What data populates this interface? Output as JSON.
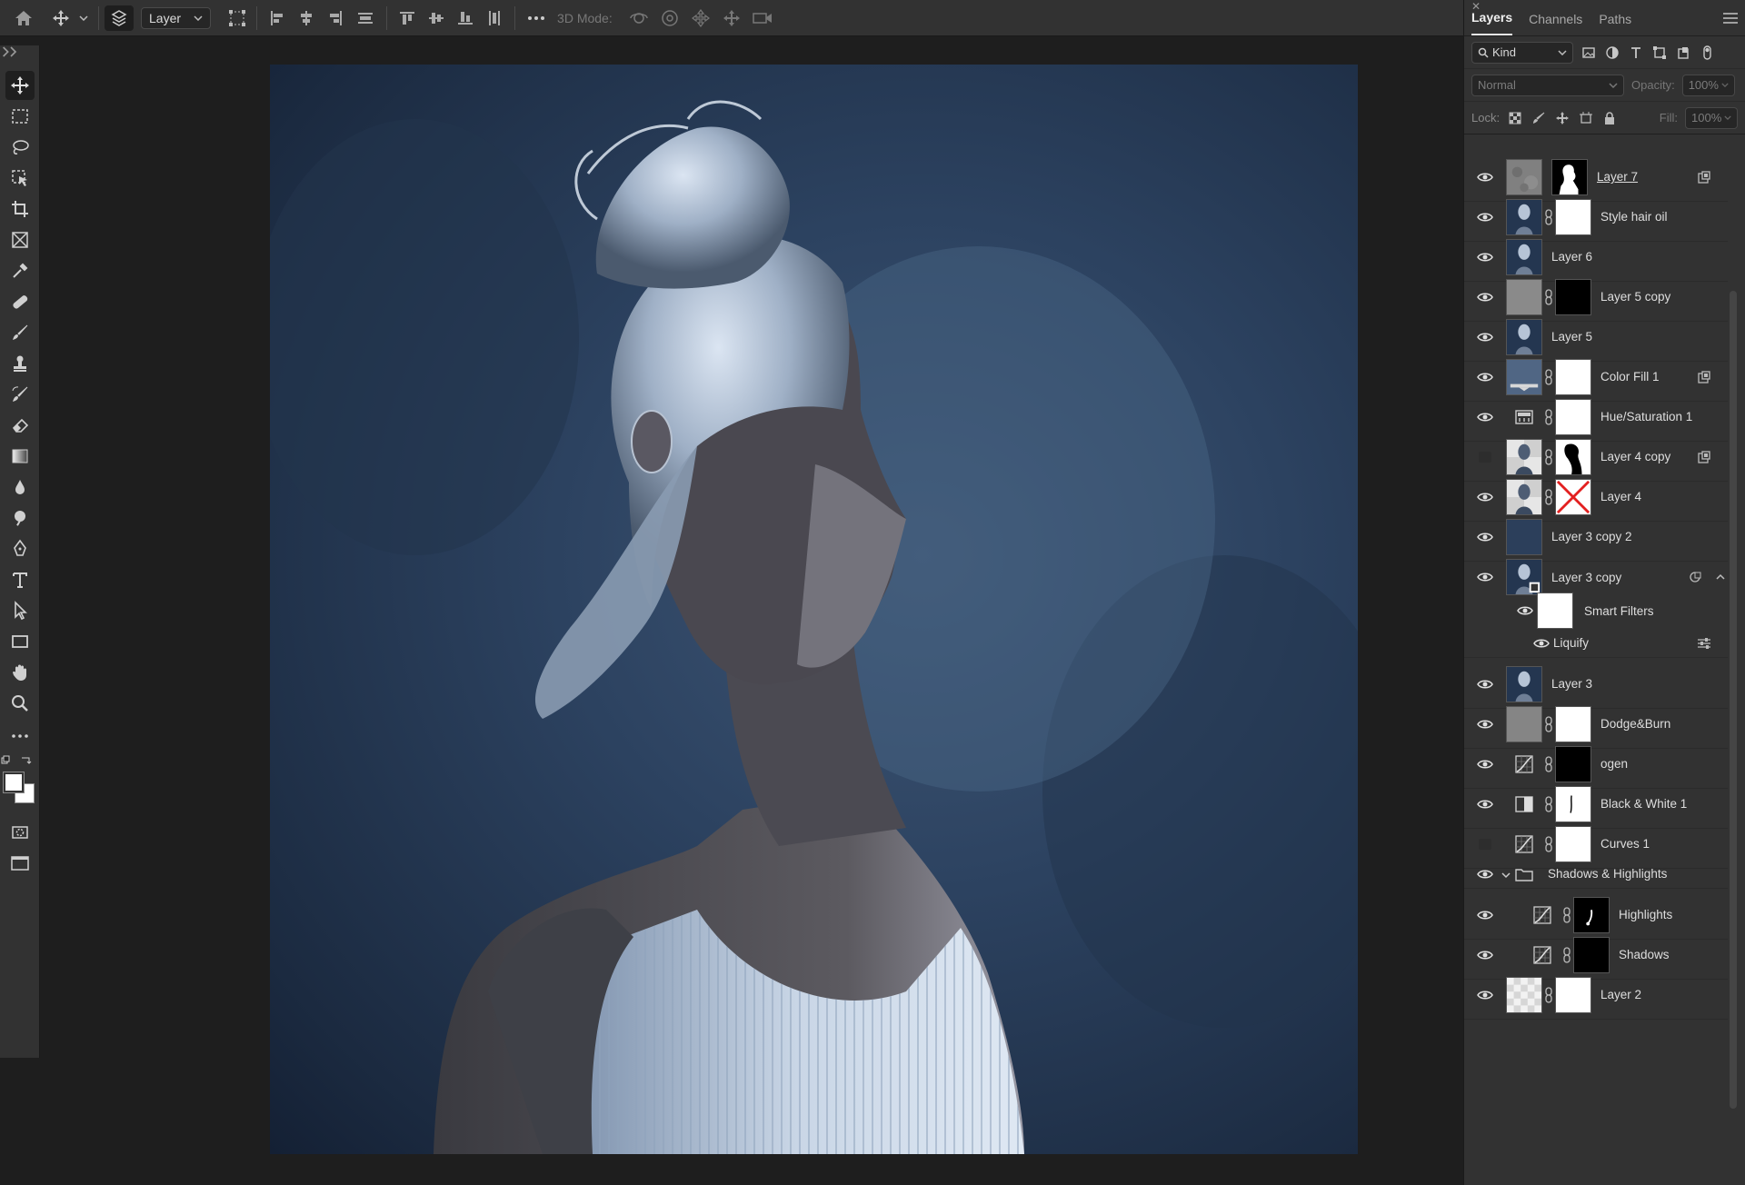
{
  "options_bar": {
    "layer_select": "Layer",
    "mode_label": "3D Mode:"
  },
  "panel": {
    "tabs": [
      "Layers",
      "Channels",
      "Paths"
    ],
    "filter_kind": "Kind",
    "blend_mode": "Normal",
    "opacity_label": "Opacity:",
    "opacity_value": "100%",
    "lock_label": "Lock:",
    "fill_label": "Fill:",
    "fill_value": "100%"
  },
  "layers": [
    {
      "name": "Layer 7",
      "visible": true,
      "selected": true
    },
    {
      "name": "Style hair oil",
      "visible": true
    },
    {
      "name": "Layer 6",
      "visible": true
    },
    {
      "name": "Layer 5 copy",
      "visible": true
    },
    {
      "name": "Layer 5",
      "visible": true
    },
    {
      "name": "Color Fill 1",
      "visible": true
    },
    {
      "name": "Hue/Saturation 1",
      "visible": true
    },
    {
      "name": "Layer 4 copy",
      "visible": false
    },
    {
      "name": "Layer 4",
      "visible": true
    },
    {
      "name": "Layer 3 copy 2",
      "visible": true
    },
    {
      "name": "Layer 3 copy",
      "visible": true
    },
    {
      "name": "Smart Filters",
      "visible": true
    },
    {
      "name": "Liquify",
      "visible": true
    },
    {
      "name": "Layer 3",
      "visible": true
    },
    {
      "name": "Dodge&Burn",
      "visible": true
    },
    {
      "name": "ogen",
      "visible": true
    },
    {
      "name": "Black & White 1",
      "visible": true
    },
    {
      "name": "Curves 1",
      "visible": false
    },
    {
      "name": "Shadows & Highlights",
      "visible": true
    },
    {
      "name": "Highlights",
      "visible": true
    },
    {
      "name": "Shadows",
      "visible": true
    },
    {
      "name": "Layer 2",
      "visible": true
    }
  ]
}
